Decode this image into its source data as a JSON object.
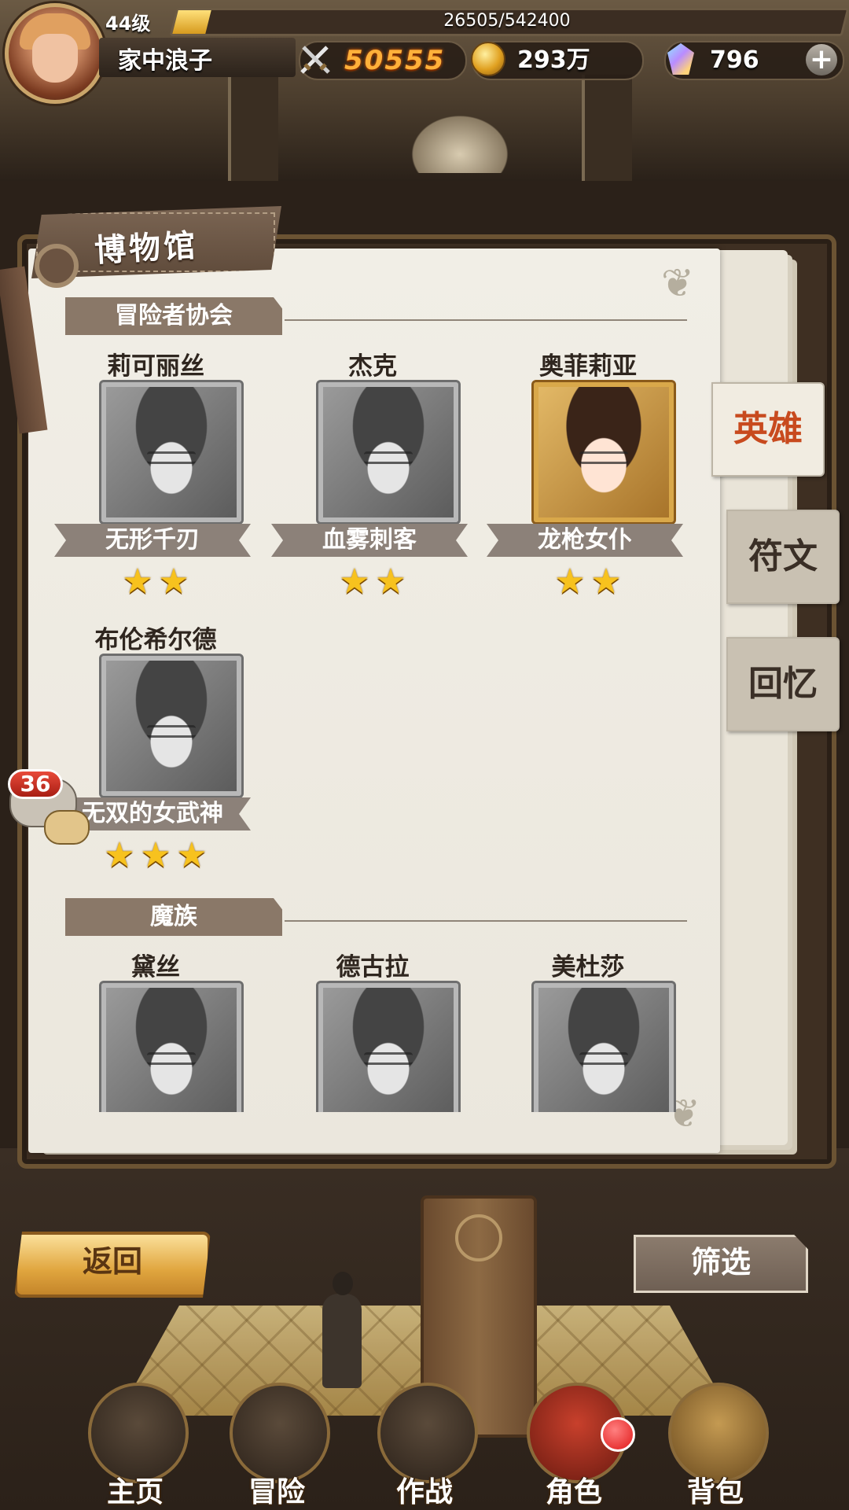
{
  "player": {
    "level": "44级",
    "exp_text": "26505/542400",
    "exp_progress": 0.049,
    "name": "家中浪子",
    "power": "50555",
    "gold": "293万",
    "gems": "796",
    "add_label": "+"
  },
  "panel": {
    "title": "博物馆",
    "tabs": [
      {
        "label": "英雄",
        "active": true
      },
      {
        "label": "符文",
        "active": false
      },
      {
        "label": "回忆",
        "active": false
      }
    ]
  },
  "sections": [
    {
      "header": "冒险者协会",
      "heroes": [
        {
          "name": "莉可丽丝",
          "title": "无形千刃",
          "stars": 2,
          "unlocked": false
        },
        {
          "name": "杰克",
          "title": "血雾刺客",
          "stars": 2,
          "unlocked": false
        },
        {
          "name": "奥菲莉亚",
          "title": "龙枪女仆",
          "stars": 2,
          "unlocked": true
        },
        {
          "name": "布伦希尔德",
          "title": "无双的女武神",
          "stars": 3,
          "unlocked": false
        }
      ]
    },
    {
      "header": "魔族",
      "heroes": [
        {
          "name": "黛丝",
          "unlocked": false
        },
        {
          "name": "德古拉",
          "unlocked": false
        },
        {
          "name": "美杜莎",
          "unlocked": false
        }
      ]
    }
  ],
  "chat": {
    "unread": "36"
  },
  "buttons": {
    "back": "返回",
    "filter": "筛选"
  },
  "nav": [
    {
      "label": "主页",
      "icon": "castle-statue-icon"
    },
    {
      "label": "冒险",
      "icon": "portal-gate-icon"
    },
    {
      "label": "作战",
      "icon": "battle-girl-icon"
    },
    {
      "label": "角色",
      "icon": "red-book-icon",
      "badge": true
    },
    {
      "label": "背包",
      "icon": "backpack-icon"
    }
  ],
  "colors": {
    "active_tab": "#c84a1e",
    "star": "#f7c21e",
    "power": "#ffb03a",
    "badge": "#e01818"
  }
}
